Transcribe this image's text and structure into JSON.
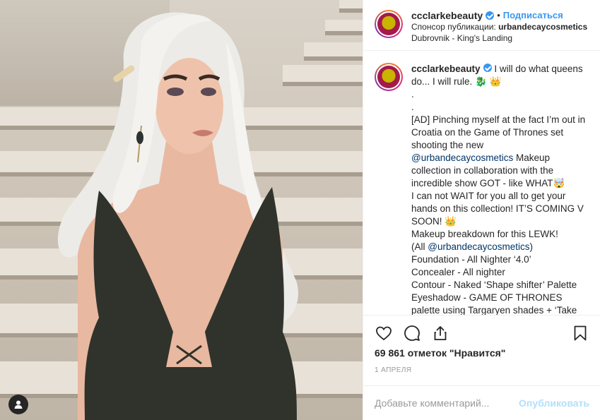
{
  "post": {
    "username": "ccclarkebeauty",
    "follow_label": "Подписаться",
    "dot": "•",
    "sponsor_prefix": "Спонсор публикации: ",
    "sponsor_name": "urbandecaycosmetics",
    "location": "Dubrovnik - King's Landing"
  },
  "caption": {
    "username": "ccclarkebeauty",
    "lines": [
      " I will do what queens do... I will rule. 🐉 👑",
      ".",
      ".",
      "[AD] Pinching myself at the fact I’m out in Croatia on the Game of Thrones set shooting the new ",
      "@urbandecaycosmetics",
      " Makeup collection in collaboration with the incredible show GOT - like WHAT🤯",
      "I can not WAIT for you all to get your hands on this collection! IT’S COMING V SOON! 👑",
      "Makeup breakdown for this LEWK!",
      "(All ",
      "@urbandecaycosmetics",
      ")",
      "Foundation - All Nighter ‘4.0’",
      "Concealer - All nighter",
      "Contour - Naked ‘Shape shifter’ Palette",
      "Eyeshadow - GAME OF THRONES palette using Targaryen shades + ‘Take"
    ]
  },
  "stats": {
    "likes": "69 861 отметок \"Нравится\"",
    "date": "1 апреля"
  },
  "comment": {
    "placeholder": "Добавьте комментарий...",
    "publish_label": "Опубликовать"
  },
  "colors": {
    "link": "#3897f0",
    "publish_disabled": "#b2dffc"
  }
}
